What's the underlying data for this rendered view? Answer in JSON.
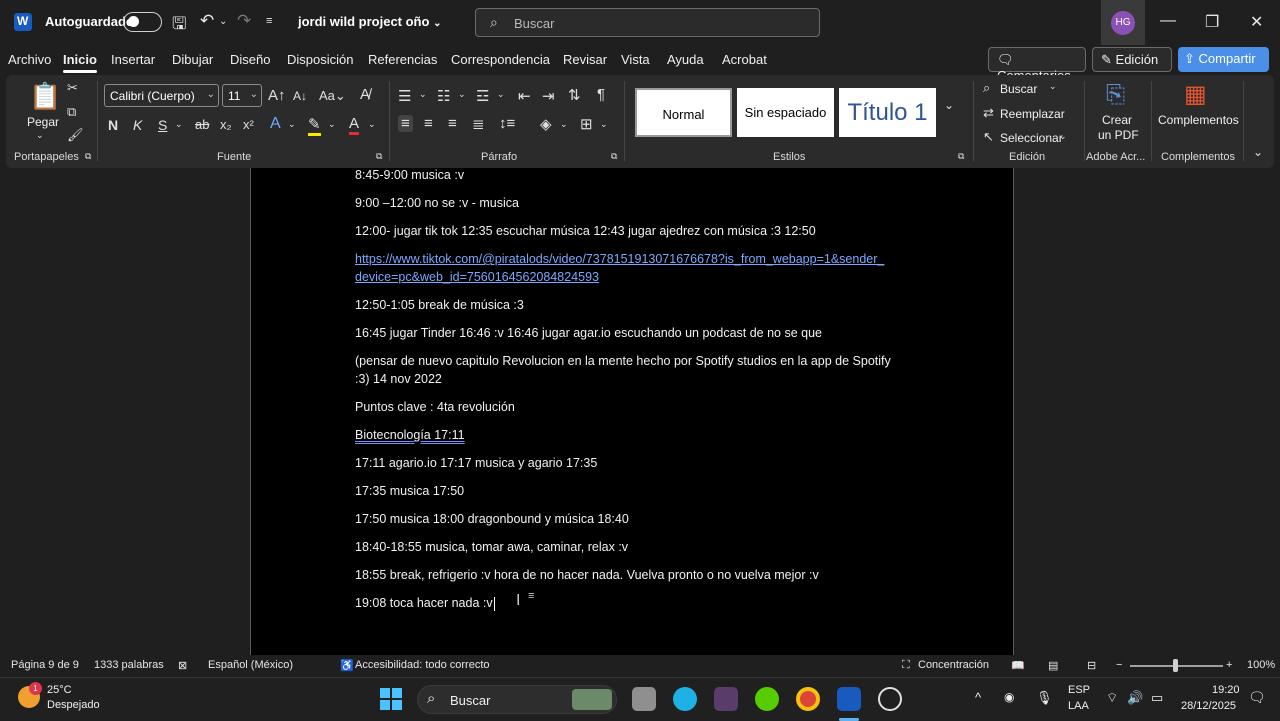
{
  "titlebar": {
    "autosave_label": "Autoguardado",
    "doc_title": "jordi wild project oño",
    "search_placeholder": "Buscar",
    "avatar_initials": "HG"
  },
  "menu": {
    "tabs": [
      "Archivo",
      "Inicio",
      "Insertar",
      "Dibujar",
      "Diseño",
      "Disposición",
      "Referencias",
      "Correspondencia",
      "Revisar",
      "Vista",
      "Ayuda",
      "Acrobat"
    ],
    "active": "Inicio",
    "comments_label": "Comentarios",
    "editing_label": "Edición",
    "share_label": "Compartir"
  },
  "ribbon": {
    "paste_label": "Pegar",
    "group_clipboard": "Portapapeles",
    "font_name": "Calibri (Cuerpo)",
    "font_size": "11",
    "group_font": "Fuente",
    "group_paragraph": "Párrafo",
    "styles": [
      "Normal",
      "Sin espaciado",
      "Título 1"
    ],
    "group_styles": "Estilos",
    "find_label": "Buscar",
    "replace_label": "Reemplazar",
    "select_label": "Seleccionar",
    "group_editing": "Edición",
    "create_pdf_line1": "Crear",
    "create_pdf_line2": "un PDF",
    "group_adobe": "Adobe Acr...",
    "addins_label": "Complementos",
    "group_addins": "Complementos"
  },
  "document": {
    "lines": [
      {
        "text": "8:45-9:00 musica :v"
      },
      {
        "text": "9:00 –12:00 no se :v  - musica"
      },
      {
        "text": "12:00- jugar tik tok 12:35 escuchar música 12:43 jugar ajedrez con música :3 12:50"
      },
      {
        "link1": "https://www.tiktok.com/@piratalods/video/7378151913071676678?is_from_webapp=1&sender_",
        "link2": "device=pc&web_id=7560164562084824593"
      },
      {
        "text": "12:50-1:05 break de música :3"
      },
      {
        "text": "16:45 jugar Tinder 16:46 :v   16:46 jugar agar.io escuchando un podcast de no se que"
      },
      {
        "text1": "(pensar de nuevo capitulo Revolucion en la mente hecho por Spotify studios en la app de Spotify",
        "text2": ":3)    14 nov 2022"
      },
      {
        "text": "Puntos clave : 4ta revolución"
      },
      {
        "text": "Biotecnología  17:11"
      },
      {
        "text": "17:11 agario.io 17:17 musica y agario  17:35"
      },
      {
        "text": "17:35 musica 17:50"
      },
      {
        "text": "17:50 musica 18:00 dragonbound y música 18:40"
      },
      {
        "text": "18:40-18:55 musica, tomar awa, caminar, relax :v"
      },
      {
        "text": "18:55 break, refrigerio :v hora de no hacer nada. Vuelva pronto o no vuelva mejor :v"
      },
      {
        "text": "19:08 toca hacer nada :v"
      }
    ]
  },
  "status": {
    "page": "Página 9 de 9",
    "words": "1333 palabras",
    "language": "Español (México)",
    "accessibility": "Accesibilidad: todo correcto",
    "focus": "Concentración",
    "zoom": "100%"
  },
  "taskbar": {
    "temp": "25°C",
    "weather": "Despejado",
    "search_label": "Buscar",
    "lang1": "ESP",
    "lang2": "LAA",
    "time": "19:20",
    "date": "28/12/2025"
  }
}
